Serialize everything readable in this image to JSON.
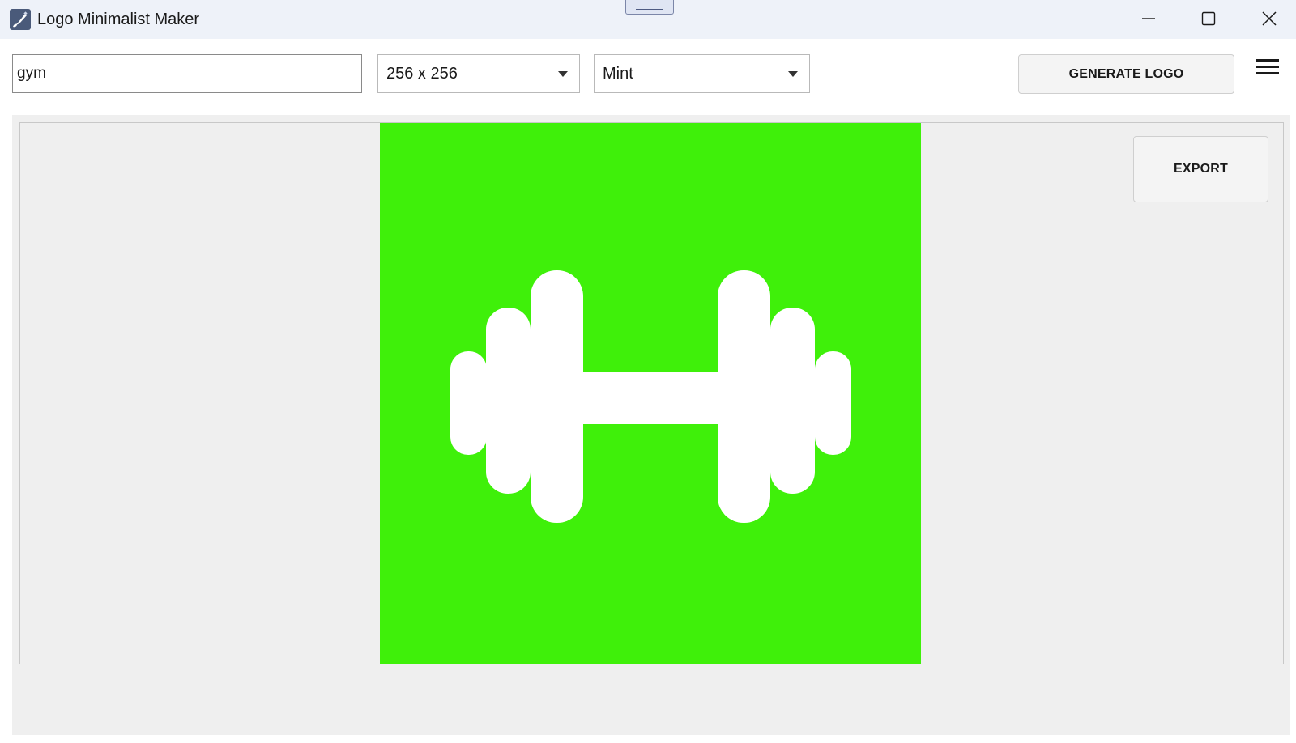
{
  "window": {
    "title": "Logo Minimalist Maker",
    "app_icon": "pen-brush-icon",
    "controls": {
      "minimize_icon": "minimize-icon",
      "maximize_icon": "maximize-icon",
      "close_icon": "close-icon"
    }
  },
  "toolbar": {
    "prompt_value": "gym",
    "size_selected": "256 x 256",
    "style_selected": "Mint",
    "generate_label": "GENERATE LOGO",
    "menu_icon": "hamburger-menu-icon"
  },
  "canvas": {
    "export_label": "EXPORT",
    "logo_icon": "dumbbell-icon",
    "logo_background": "#3ff00a",
    "logo_foreground": "#ffffff",
    "panel_background": "#efefef"
  },
  "colors": {
    "titlebar": "#eef2f9",
    "button_background": "#f4f4f4"
  }
}
